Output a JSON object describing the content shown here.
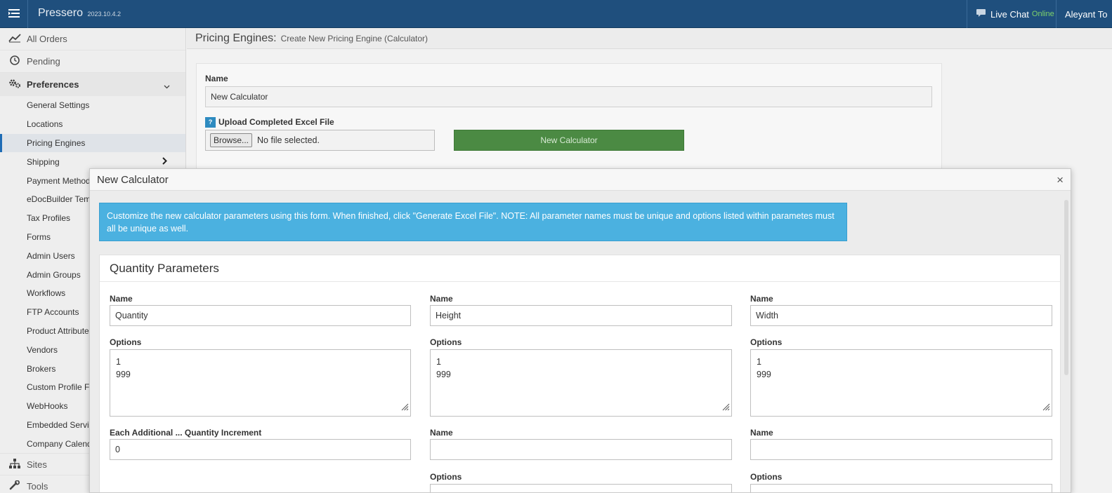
{
  "topbar": {
    "brand": "Pressero",
    "version": "2023.10.4.2",
    "chat_label": "Live Chat",
    "chat_status": "Online",
    "user_name": "Aleyant To"
  },
  "sidebar": {
    "all_orders": "All Orders",
    "pending": "Pending",
    "preferences": "Preferences",
    "items": [
      {
        "label": "General Settings"
      },
      {
        "label": "Locations"
      },
      {
        "label": "Pricing Engines"
      },
      {
        "label": "Shipping"
      },
      {
        "label": "Payment Methods"
      },
      {
        "label": "eDocBuilder Templates"
      },
      {
        "label": "Tax Profiles"
      },
      {
        "label": "Forms"
      },
      {
        "label": "Admin Users"
      },
      {
        "label": "Admin Groups"
      },
      {
        "label": "Workflows"
      },
      {
        "label": "FTP Accounts"
      },
      {
        "label": "Product Attributes"
      },
      {
        "label": "Vendors"
      },
      {
        "label": "Brokers"
      },
      {
        "label": "Custom Profile Fields"
      },
      {
        "label": "WebHooks"
      },
      {
        "label": "Embedded Services"
      },
      {
        "label": "Company Calendar"
      }
    ],
    "sites": "Sites",
    "tools": "Tools"
  },
  "header": {
    "title": "Pricing Engines:",
    "subtitle": "Create New Pricing Engine (Calculator)"
  },
  "form": {
    "name_label": "Name",
    "name_value": "New Calculator",
    "upload_help": "?",
    "upload_label": "Upload Completed Excel File",
    "browse_label": "Browse...",
    "file_status": "No file selected.",
    "new_calc_button": "New Calculator"
  },
  "modal": {
    "title": "New Calculator",
    "close": "×",
    "info": "Customize the new calculator parameters using this form. When finished, click \"Generate Excel File\". NOTE: All parameter names must be unique and options listed within parametes must all be unique as well.",
    "section_title": "Quantity Parameters",
    "columns": [
      {
        "name_label": "Name",
        "name_value": "Quantity",
        "options_label": "Options",
        "options_line1": "1",
        "options_line2": "999"
      },
      {
        "name_label": "Name",
        "name_value": "Height",
        "options_label": "Options",
        "options_line1": "1",
        "options_line2": "999"
      },
      {
        "name_label": "Name",
        "name_value": "Width",
        "options_label": "Options",
        "options_line1": "1",
        "options_line2": "999"
      }
    ],
    "increment_label": "Each Additional ... Quantity Increment",
    "increment_value": "0",
    "extra_name_label": "Name",
    "extra_options_label": "Options"
  },
  "colors": {
    "topbar": "#1f4f7d",
    "info_box": "#4bb1e0",
    "green_button": "#4b8a43",
    "active_nav": "#1f6cb5"
  }
}
